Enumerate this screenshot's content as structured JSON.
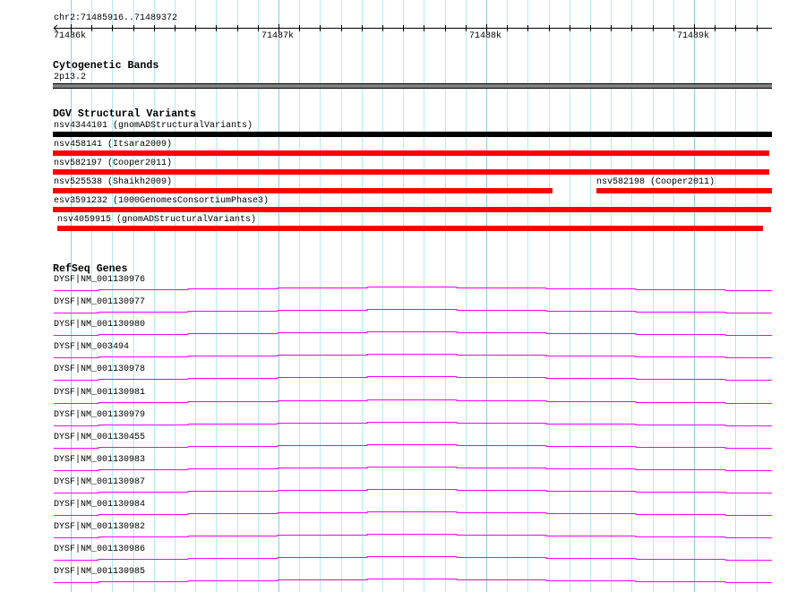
{
  "ruler": {
    "location": "chr2:71485916..71489372",
    "start": 71485916,
    "end": 71489372,
    "major_ticks": [
      "71486k",
      "71487k",
      "71488k",
      "71489k"
    ]
  },
  "cytoband": {
    "title": "Cytogenetic Bands",
    "band": "2p13.2",
    "color": "#808080"
  },
  "dgv": {
    "title": "DGV Structural Variants",
    "variants": [
      {
        "label": "nsv4344101 (gnomADStructuralVariants)",
        "color": "#000000"
      },
      {
        "label": "nsv458141 (Itsara2009)",
        "color": "#ff0000"
      },
      {
        "label": "nsv582197 (Cooper2011)",
        "color": "#ff0000"
      },
      {
        "label": "nsv525538 (Shaikh2009)",
        "color": "#ff0000"
      },
      {
        "label": "nsv582198 (Cooper2011)",
        "color": "#ff0000"
      },
      {
        "label": "esv3591232 (1000GenomesConsortiumPhase3)",
        "color": "#ff0000"
      },
      {
        "label": "nsv4059915 (gnomADStructuralVariants)",
        "color": "#ff0000"
      }
    ]
  },
  "refseq": {
    "title": "RefSeq Genes",
    "color": "#ff00ff",
    "genes": [
      "DYSF|NM_001130976",
      "DYSF|NM_001130977",
      "DYSF|NM_001130980",
      "DYSF|NM_003494",
      "DYSF|NM_001130978",
      "DYSF|NM_001130981",
      "DYSF|NM_001130979",
      "DYSF|NM_001130455",
      "DYSF|NM_001130983",
      "DYSF|NM_001130987",
      "DYSF|NM_001130984",
      "DYSF|NM_001130982",
      "DYSF|NM_001130986",
      "DYSF|NM_001130985"
    ]
  }
}
